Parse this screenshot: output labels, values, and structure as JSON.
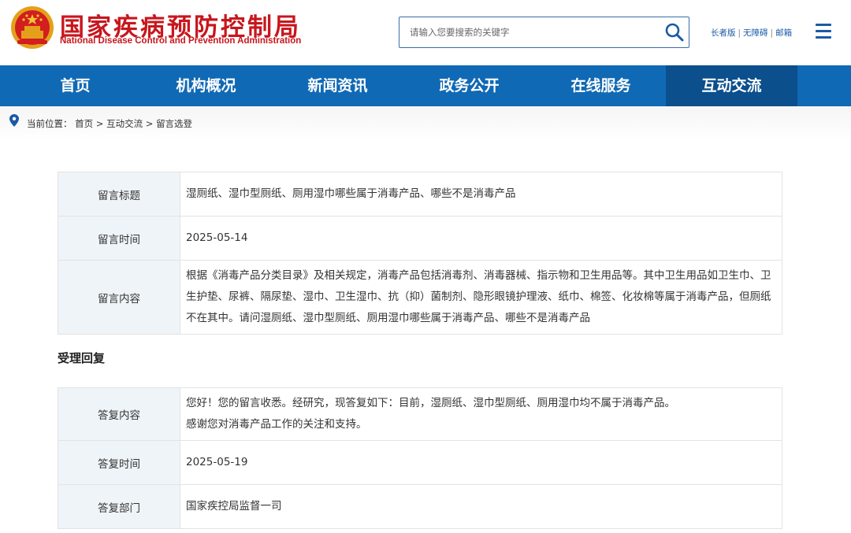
{
  "header": {
    "site_title": "国家疾病预防控制局",
    "site_subtitle": "National Disease Control and Prevention Administration",
    "emblem_icon": "national-emblem-icon",
    "search": {
      "placeholder": "请输入您要搜索的关键字",
      "icon": "search-icon"
    },
    "util_links": [
      "长者版",
      "无障碍",
      "邮箱"
    ],
    "menu_icon": "hamburger-menu-icon"
  },
  "nav": {
    "items": [
      "首页",
      "机构概况",
      "新闻资讯",
      "政务公开",
      "在线服务",
      "互动交流"
    ],
    "active_index": 5
  },
  "breadcrumb": {
    "prefix": "当前位置：",
    "items": [
      "首页",
      "互动交流",
      "留言选登"
    ],
    "separator": " > "
  },
  "message": {
    "rows": [
      {
        "label": "留言标题",
        "value": "湿厕纸、湿巾型厕纸、厕用湿巾哪些属于消毒产品、哪些不是消毒产品"
      },
      {
        "label": "留言时间",
        "value": "2025-05-14"
      },
      {
        "label": "留言内容",
        "value": "根据《消毒产品分类目录》及相关规定，消毒产品包括消毒剂、消毒器械、指示物和卫生用品等。其中卫生用品如卫生巾、卫生护垫、尿裤、隔尿垫、湿巾、卫生湿巾、抗（抑）菌制剂、隐形眼镜护理液、纸巾、棉签、化妆棉等属于消毒产品，但厕纸不在其中。请问湿厕纸、湿巾型厕纸、厕用湿巾哪些属于消毒产品、哪些不是消毒产品"
      }
    ]
  },
  "reply": {
    "section_title": "受理回复",
    "content_label": "答复内容",
    "content_lines": [
      "您好！您的留言收悉。经研究，现答复如下：目前，湿厕纸、湿巾型厕纸、厕用湿巾均不属于消毒产品。",
      "感谢您对消毒产品工作的关注和支持。"
    ],
    "rows": [
      {
        "label": "答复时间",
        "value": "2025-05-19"
      },
      {
        "label": "答复部门",
        "value": "国家疾控局监督一司"
      }
    ]
  },
  "colors": {
    "brand_red": "#c8161d",
    "nav_blue": "#1069b4",
    "nav_active": "#0b4f8c",
    "label_bg": "#eff4f8",
    "link_blue": "#1a5aa6"
  }
}
